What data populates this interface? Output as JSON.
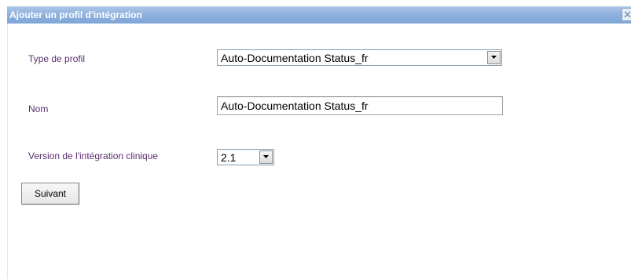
{
  "dialog": {
    "title": "Ajouter un profil d'intégration"
  },
  "form": {
    "profile_type": {
      "label": "Type de profil",
      "selected": "Auto-Documentation Status_fr"
    },
    "name": {
      "label": "Nom",
      "value": "Auto-Documentation Status_fr"
    },
    "clinical_version": {
      "label": "Version de l'intégration clinique",
      "selected": "2.1"
    },
    "next_button_label": "Suivant"
  },
  "icons": {
    "close": "close-icon",
    "dropdown": "chevron-down-icon"
  },
  "colors": {
    "titlebar": "#8fb1de",
    "label_text": "#5a2d6e"
  }
}
